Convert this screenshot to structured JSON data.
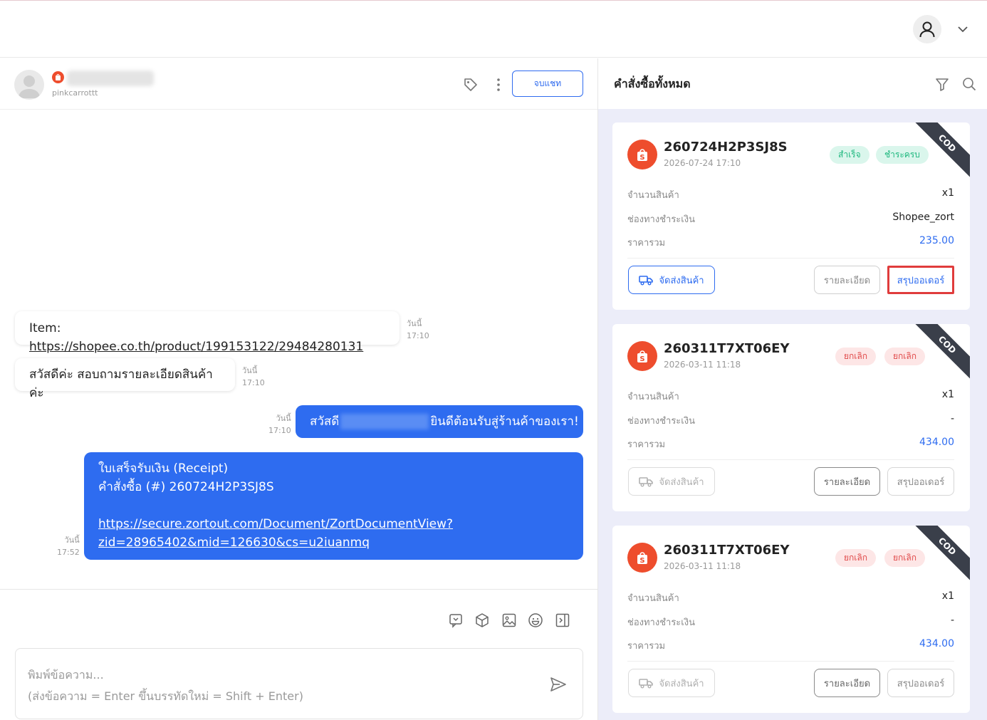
{
  "chat": {
    "username": "pinkcarrottt",
    "end_chat_label": "จบแชท",
    "messages": {
      "m1": {
        "prefix": "Item: ",
        "link": "https://shopee.co.th/product/199153122/29484280131",
        "day": "วันนี้",
        "time": "17:10"
      },
      "m2": {
        "text": "สวัสดีค่ะ สอบถามรายละเอียดสินค้าค่ะ",
        "day": "วันนี้",
        "time": "17:10"
      },
      "m3": {
        "prefix": "สวัสดี",
        "suffix": "ยินดีต้อนรับสู่ร้านค้าของเรา!",
        "day": "วันนี้",
        "time": "17:10"
      },
      "m4": {
        "line1": "ใบเสร็จรับเงิน (Receipt)",
        "line2": "คำสั่งซื้อ (#) 260724H2P3SJ8S",
        "link1": "https://secure.zortout.com/Document/ZortDocumentView?",
        "link2": "zid=28965402&mid=126630&cs=u2iuanmq",
        "day": "วันนี้",
        "time": "17:52"
      }
    },
    "composer": {
      "placeholder1": "พิมพ์ข้อความ...",
      "placeholder2": "(ส่งข้อความ = Enter ขึ้นบรรทัดใหม่ = Shift + Enter)"
    },
    "tools": [
      "chat-template-icon",
      "package-icon",
      "image-icon",
      "emoji-icon",
      "panel-toggle-icon"
    ]
  },
  "orders": {
    "title": "คำสั่งซื้อทั้งหมด",
    "labels": {
      "qty": "จำนวนสินค้า",
      "payment": "ช่องทางชำระเงิน",
      "total": "ราคารวม",
      "ship": "จัดส่งสินค้า",
      "detail": "รายละเอียด",
      "summary": "สรุปออเดอร์"
    },
    "cod": "COD",
    "list": {
      "o1": {
        "id": "260724H2P3SJ8S",
        "date": "2026-07-24 17:10",
        "badge1": "สำเร็จ",
        "badge2": "ชำระครบ",
        "qty": "x1",
        "payment": "Shopee_zort",
        "total": "235.00"
      },
      "o2": {
        "id": "260311T7XT06EY",
        "date": "2026-03-11 11:18",
        "badge1": "ยกเลิก",
        "badge2": "ยกเลิก",
        "qty": "x1",
        "payment": "-",
        "total": "434.00"
      },
      "o3": {
        "id": "260311T7XT06EY",
        "date": "2026-03-11 11:18",
        "badge1": "ยกเลิก",
        "badge2": "ยกเลิก",
        "qty": "x1",
        "payment": "-",
        "total": "434.00"
      }
    }
  },
  "colors": {
    "accent": "#2e6cf0",
    "shopee": "#ee4d2d",
    "success": "#1fb87f",
    "cancel": "#e04848",
    "highlight": "#e03c3c"
  }
}
